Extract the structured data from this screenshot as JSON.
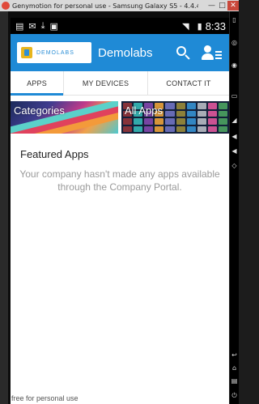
{
  "window": {
    "title": "Genymotion for personal use - Samsung Galaxy S5 - 4.4.4 - AP...",
    "minimize_icon": "minimize-icon",
    "maximize_icon": "maximize-icon",
    "close_icon": "close-icon",
    "minimize_glyph": "—",
    "maximize_glyph": "□",
    "close_glyph": "✕",
    "close_color": "#c9483b",
    "watermark": "free for personal use"
  },
  "statusbar": {
    "time": "8:33",
    "icons": [
      "screenshot-icon",
      "email-icon",
      "download-icon",
      "gallery-icon",
      "wifi-icon",
      "battery-icon"
    ]
  },
  "appbar": {
    "logo_text": "DEMOLABS",
    "title": "Demolabs",
    "accent_color": "#1f8ad6",
    "search_icon": "search-icon",
    "account_icon": "account-menu-icon"
  },
  "tabs": [
    {
      "label": "APPS",
      "active": true
    },
    {
      "label": "MY DEVICES",
      "active": false
    },
    {
      "label": "CONTACT IT",
      "active": false
    }
  ],
  "tiles": {
    "categories_label": "Categories",
    "all_apps_label": "All Apps"
  },
  "featured": {
    "title": "Featured Apps",
    "empty_message": "Your company hasn't made any apps available through the Company Portal."
  }
}
